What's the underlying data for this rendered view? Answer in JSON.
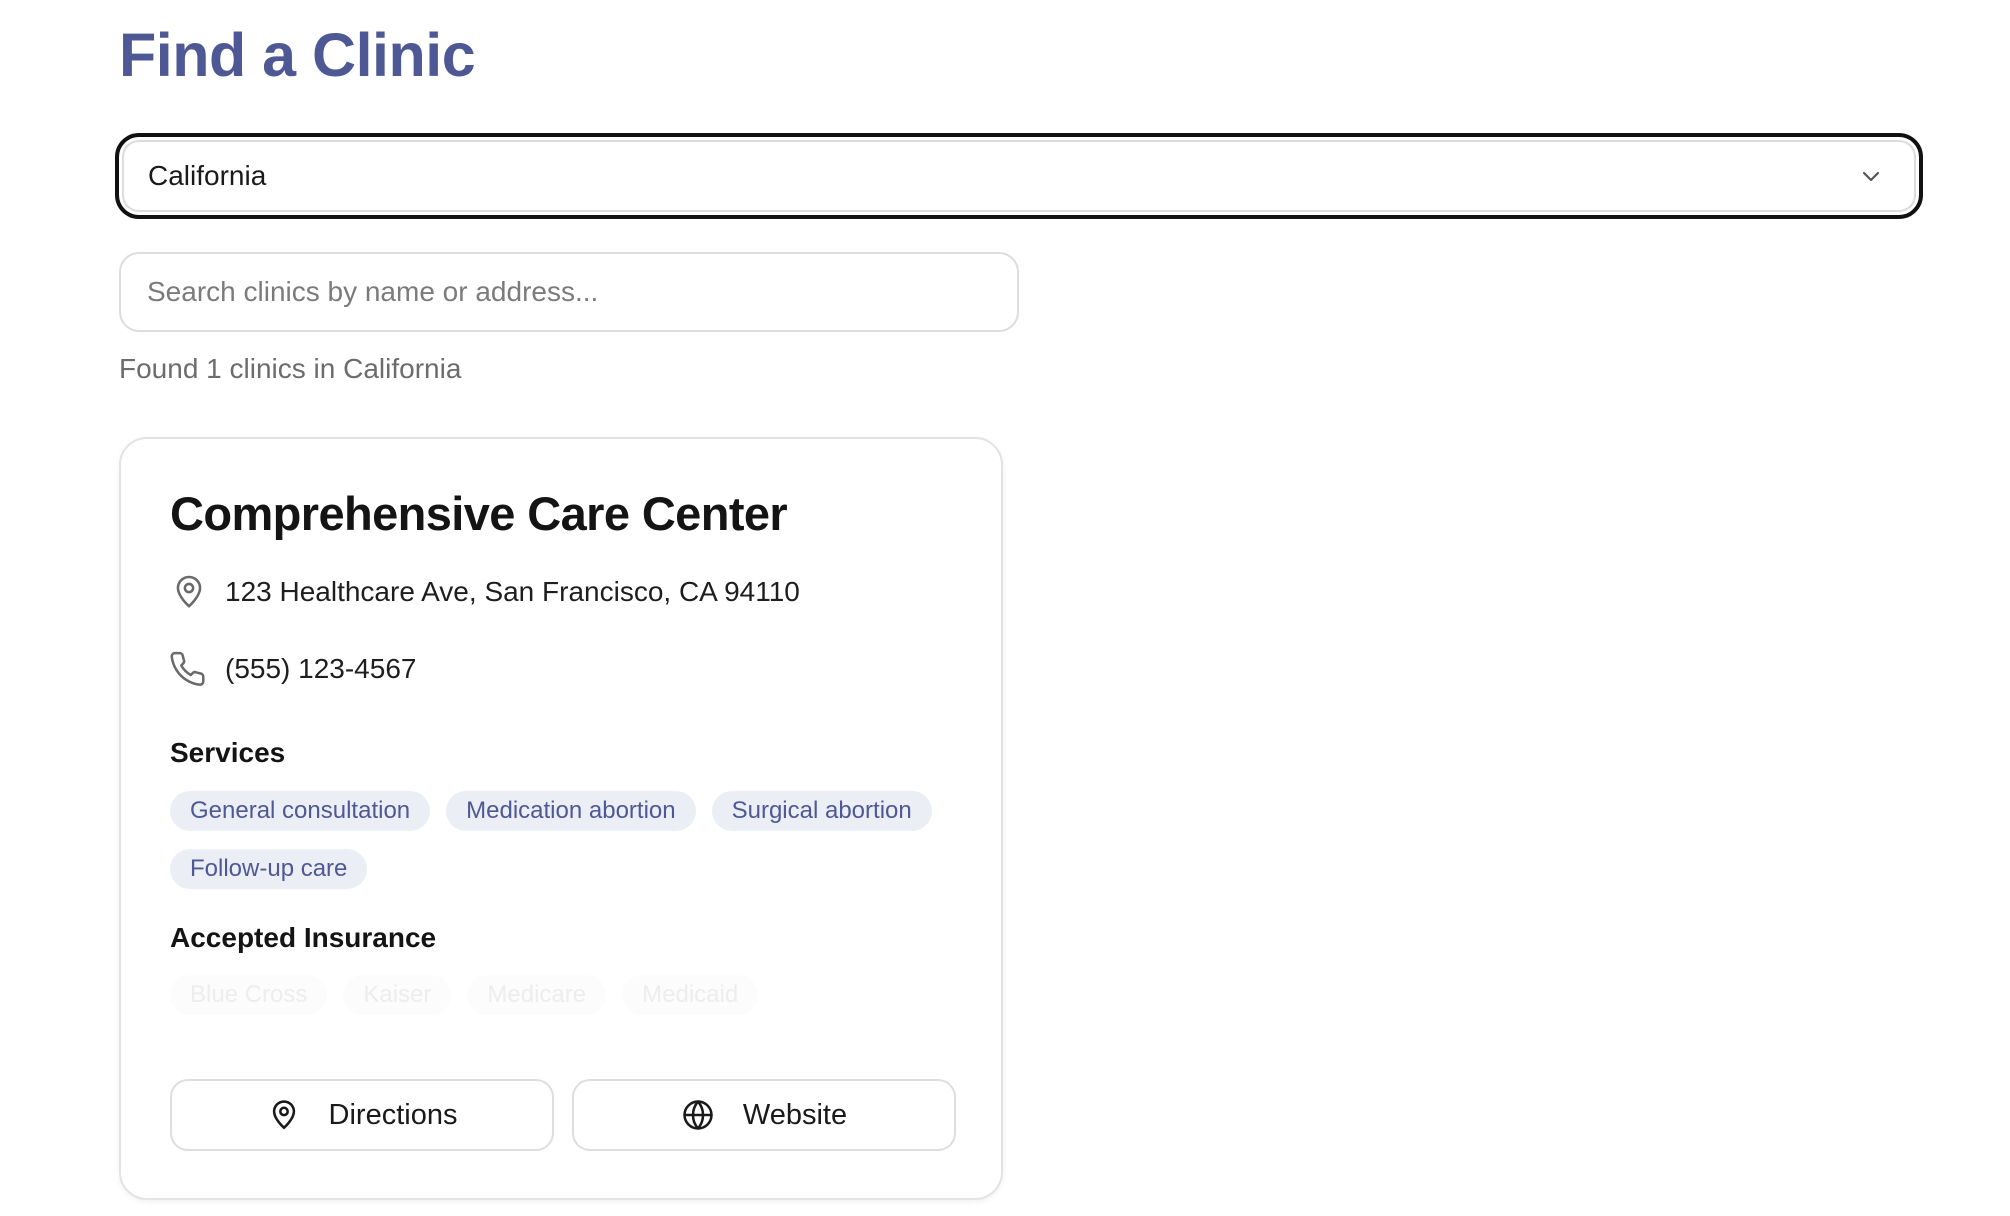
{
  "page": {
    "title": "Find a Clinic"
  },
  "state_select": {
    "value": "California",
    "icon": "chevron-down-icon"
  },
  "search": {
    "placeholder": "Search clinics by name or address..."
  },
  "results": {
    "summary": "Found 1 clinics in California"
  },
  "clinics": [
    {
      "name": "Comprehensive Care Center",
      "address": "123 Healthcare Ave, San Francisco, CA 94110",
      "phone": "(555) 123-4567",
      "services_label": "Services",
      "services": [
        "General consultation",
        "Medication abortion",
        "Surgical abortion",
        "Follow-up care"
      ],
      "insurance_label": "Accepted Insurance",
      "insurance": [
        "Blue Cross",
        "Kaiser",
        "Medicare",
        "Medicaid"
      ],
      "directions_label": "Directions",
      "website_label": "Website"
    }
  ],
  "icons": [
    "map-pin-icon",
    "phone-icon",
    "globe-icon"
  ],
  "colors": {
    "accent": "#4e5894",
    "tag_bg": "#eceef5"
  }
}
